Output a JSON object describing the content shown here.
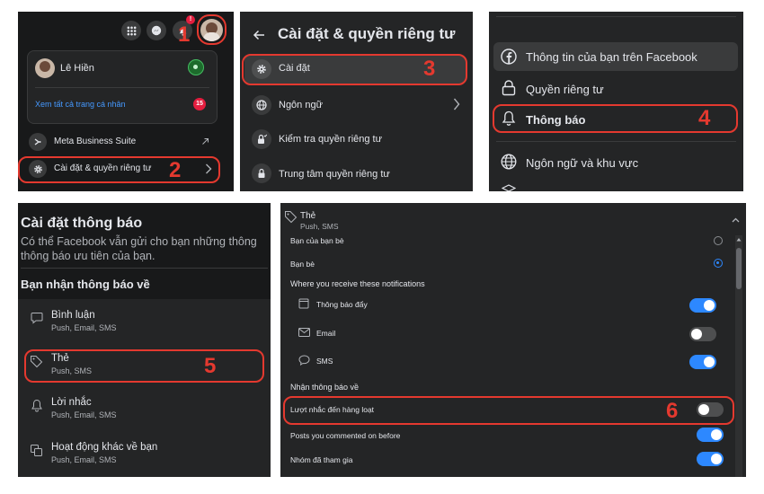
{
  "steps": [
    "1",
    "2",
    "3",
    "4",
    "5",
    "6"
  ],
  "panel1": {
    "notif_badge": "!",
    "profile_name": "Lê Hiền",
    "see_all": "Xem tất cả trang cá nhân",
    "see_all_badge": "15",
    "meta_business": "Meta Business Suite",
    "settings_privacy": "Cài đặt & quyền riêng tư"
  },
  "panel2": {
    "title": "Cài đặt & quyền riêng tư",
    "items": [
      "Cài đặt",
      "Ngôn ngữ",
      "Kiểm tra quyền riêng tư",
      "Trung tâm quyền riêng tư"
    ]
  },
  "panel3": {
    "items": [
      "Thông tin của bạn trên Facebook",
      "Quyền riêng tư",
      "Thông báo",
      "Ngôn ngữ và khu vực"
    ]
  },
  "panel4": {
    "title": "Cài đặt thông báo",
    "desc_line1": "Có thể Facebook vẫn gửi cho bạn những thông",
    "desc_line2": "thông báo ưu tiên của bạn.",
    "section": "Bạn nhận thông báo về",
    "items": [
      {
        "title": "Bình luận",
        "sub": "Push, Email, SMS"
      },
      {
        "title": "Thẻ",
        "sub": "Push, SMS"
      },
      {
        "title": "Lời nhắc",
        "sub": "Push, Email, SMS"
      },
      {
        "title": "Hoạt động khác về bạn",
        "sub": "Push, Email, SMS"
      }
    ]
  },
  "panel5": {
    "header_title": "Thẻ",
    "header_sub": "Push, SMS",
    "radio_friends_of_friends": "Bạn của bạn bè",
    "radio_friends": "Bạn bè",
    "where_heading": "Where you receive these notifications",
    "channels": [
      {
        "label": "Thông báo đẩy",
        "on": true
      },
      {
        "label": "Email",
        "on": false
      },
      {
        "label": "SMS",
        "on": true
      }
    ],
    "about_heading": "Nhận thông báo về",
    "about_items": [
      {
        "label": "Lượt nhắc đến hàng loạt",
        "on": false
      },
      {
        "label": "Posts you commented on before",
        "on": true
      },
      {
        "label": "Nhóm đã tham gia",
        "on": true
      }
    ]
  },
  "colors": {
    "accent": "#2d88ff",
    "highlight": "#e4392f",
    "panel_bg": "#242526"
  }
}
